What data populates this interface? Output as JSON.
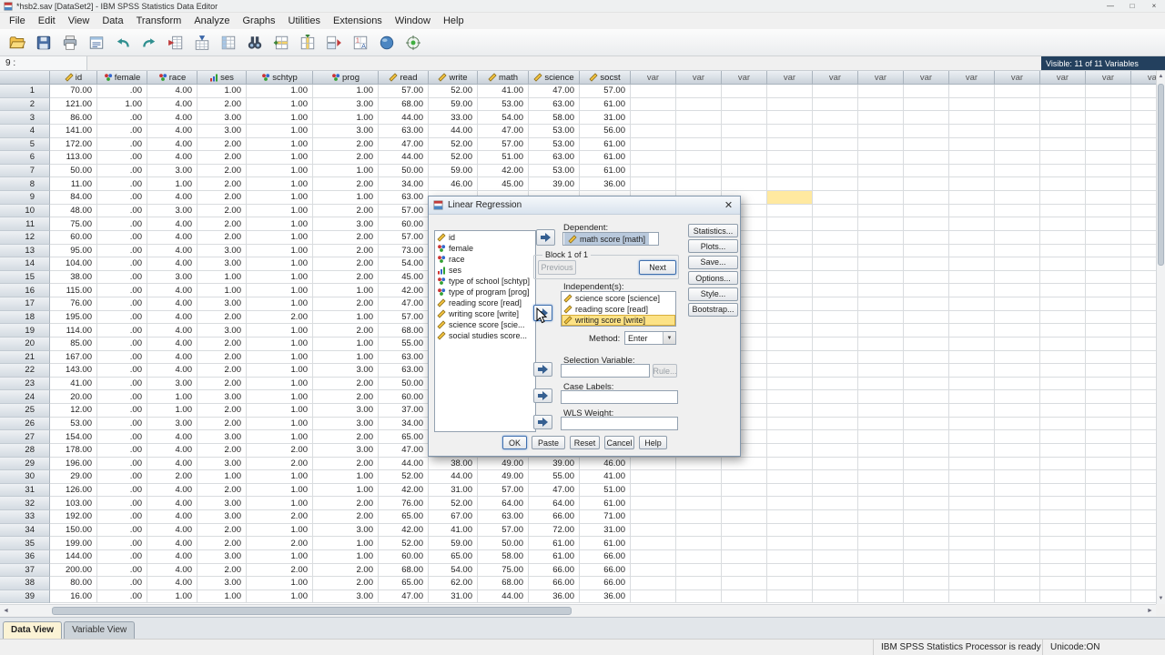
{
  "window": {
    "title": "*hsb2.sav [DataSet2] - IBM SPSS Statistics Data Editor"
  },
  "menu": {
    "items": [
      "File",
      "Edit",
      "View",
      "Data",
      "Transform",
      "Analyze",
      "Graphs",
      "Utilities",
      "Extensions",
      "Window",
      "Help"
    ]
  },
  "toolbar": {
    "icons": [
      "open-data-icon",
      "save-icon",
      "print-icon",
      "recall-dialogs-icon",
      "undo-icon",
      "redo-icon",
      "goto-case-icon",
      "goto-variable-icon",
      "variables-icon",
      "find-icon",
      "insert-cases-icon",
      "insert-variable-icon",
      "split-file-icon",
      "value-labels-icon",
      "use-variable-sets-icon",
      "show-all-variables-icon"
    ]
  },
  "cellref": {
    "value": "9 :"
  },
  "header_info": {
    "visible": "Visible: 11 of 11 Variables"
  },
  "grid": {
    "var_label": "var",
    "columns": [
      {
        "label": "id",
        "measure": "scale"
      },
      {
        "label": "female",
        "measure": "nominal"
      },
      {
        "label": "race",
        "measure": "nominal"
      },
      {
        "label": "ses",
        "measure": "ordinal"
      },
      {
        "label": "schtyp",
        "measure": "nominal"
      },
      {
        "label": "prog",
        "measure": "nominal"
      },
      {
        "label": "read",
        "measure": "scale"
      },
      {
        "label": "write",
        "measure": "scale"
      },
      {
        "label": "math",
        "measure": "scale"
      },
      {
        "label": "science",
        "measure": "scale"
      },
      {
        "label": "socst",
        "measure": "scale"
      }
    ],
    "active_cell": {
      "row": "9",
      "var_index": 3
    },
    "rows": [
      [
        "1",
        "70.00",
        ".00",
        "4.00",
        "1.00",
        "1.00",
        "1.00",
        "57.00",
        "52.00",
        "41.00",
        "47.00",
        "57.00"
      ],
      [
        "2",
        "121.00",
        "1.00",
        "4.00",
        "2.00",
        "1.00",
        "3.00",
        "68.00",
        "59.00",
        "53.00",
        "63.00",
        "61.00"
      ],
      [
        "3",
        "86.00",
        ".00",
        "4.00",
        "3.00",
        "1.00",
        "1.00",
        "44.00",
        "33.00",
        "54.00",
        "58.00",
        "31.00"
      ],
      [
        "4",
        "141.00",
        ".00",
        "4.00",
        "3.00",
        "1.00",
        "3.00",
        "63.00",
        "44.00",
        "47.00",
        "53.00",
        "56.00"
      ],
      [
        "5",
        "172.00",
        ".00",
        "4.00",
        "2.00",
        "1.00",
        "2.00",
        "47.00",
        "52.00",
        "57.00",
        "53.00",
        "61.00"
      ],
      [
        "6",
        "113.00",
        ".00",
        "4.00",
        "2.00",
        "1.00",
        "2.00",
        "44.00",
        "52.00",
        "51.00",
        "63.00",
        "61.00"
      ],
      [
        "7",
        "50.00",
        ".00",
        "3.00",
        "2.00",
        "1.00",
        "1.00",
        "50.00",
        "59.00",
        "42.00",
        "53.00",
        "61.00"
      ],
      [
        "8",
        "11.00",
        ".00",
        "1.00",
        "2.00",
        "1.00",
        "2.00",
        "34.00",
        "46.00",
        "45.00",
        "39.00",
        "36.00"
      ],
      [
        "9",
        "84.00",
        ".00",
        "4.00",
        "2.00",
        "1.00",
        "1.00",
        "63.00",
        "",
        "",
        "",
        ""
      ],
      [
        "10",
        "48.00",
        ".00",
        "3.00",
        "2.00",
        "1.00",
        "2.00",
        "57.00",
        "",
        "",
        "",
        ""
      ],
      [
        "11",
        "75.00",
        ".00",
        "4.00",
        "2.00",
        "1.00",
        "3.00",
        "60.00",
        "",
        "",
        "",
        ""
      ],
      [
        "12",
        "60.00",
        ".00",
        "4.00",
        "2.00",
        "1.00",
        "2.00",
        "57.00",
        "",
        "",
        "",
        ""
      ],
      [
        "13",
        "95.00",
        ".00",
        "4.00",
        "3.00",
        "1.00",
        "2.00",
        "73.00",
        "",
        "",
        "",
        ""
      ],
      [
        "14",
        "104.00",
        ".00",
        "4.00",
        "3.00",
        "1.00",
        "2.00",
        "54.00",
        "",
        "",
        "",
        ""
      ],
      [
        "15",
        "38.00",
        ".00",
        "3.00",
        "1.00",
        "1.00",
        "2.00",
        "45.00",
        "",
        "",
        "",
        ""
      ],
      [
        "16",
        "115.00",
        ".00",
        "4.00",
        "1.00",
        "1.00",
        "1.00",
        "42.00",
        "",
        "",
        "",
        ""
      ],
      [
        "17",
        "76.00",
        ".00",
        "4.00",
        "3.00",
        "1.00",
        "2.00",
        "47.00",
        "",
        "",
        "",
        ""
      ],
      [
        "18",
        "195.00",
        ".00",
        "4.00",
        "2.00",
        "2.00",
        "1.00",
        "57.00",
        "",
        "",
        "",
        ""
      ],
      [
        "19",
        "114.00",
        ".00",
        "4.00",
        "3.00",
        "1.00",
        "2.00",
        "68.00",
        "",
        "",
        "",
        ""
      ],
      [
        "20",
        "85.00",
        ".00",
        "4.00",
        "2.00",
        "1.00",
        "1.00",
        "55.00",
        "",
        "",
        "",
        ""
      ],
      [
        "21",
        "167.00",
        ".00",
        "4.00",
        "2.00",
        "1.00",
        "1.00",
        "63.00",
        "",
        "",
        "",
        ""
      ],
      [
        "22",
        "143.00",
        ".00",
        "4.00",
        "2.00",
        "1.00",
        "3.00",
        "63.00",
        "",
        "",
        "",
        ""
      ],
      [
        "23",
        "41.00",
        ".00",
        "3.00",
        "2.00",
        "1.00",
        "2.00",
        "50.00",
        "",
        "",
        "",
        ""
      ],
      [
        "24",
        "20.00",
        ".00",
        "1.00",
        "3.00",
        "1.00",
        "2.00",
        "60.00",
        "",
        "",
        "",
        ""
      ],
      [
        "25",
        "12.00",
        ".00",
        "1.00",
        "2.00",
        "1.00",
        "3.00",
        "37.00",
        "",
        "",
        "",
        ""
      ],
      [
        "26",
        "53.00",
        ".00",
        "3.00",
        "2.00",
        "1.00",
        "3.00",
        "34.00",
        "",
        "",
        "",
        ""
      ],
      [
        "27",
        "154.00",
        ".00",
        "4.00",
        "3.00",
        "1.00",
        "2.00",
        "65.00",
        "",
        "",
        "",
        ""
      ],
      [
        "28",
        "178.00",
        ".00",
        "4.00",
        "2.00",
        "2.00",
        "3.00",
        "47.00",
        "",
        "",
        "",
        ""
      ],
      [
        "29",
        "196.00",
        ".00",
        "4.00",
        "3.00",
        "2.00",
        "2.00",
        "44.00",
        "38.00",
        "49.00",
        "39.00",
        "46.00"
      ],
      [
        "30",
        "29.00",
        ".00",
        "2.00",
        "1.00",
        "1.00",
        "1.00",
        "52.00",
        "44.00",
        "49.00",
        "55.00",
        "41.00"
      ],
      [
        "31",
        "126.00",
        ".00",
        "4.00",
        "2.00",
        "1.00",
        "1.00",
        "42.00",
        "31.00",
        "57.00",
        "47.00",
        "51.00"
      ],
      [
        "32",
        "103.00",
        ".00",
        "4.00",
        "3.00",
        "1.00",
        "2.00",
        "76.00",
        "52.00",
        "64.00",
        "64.00",
        "61.00"
      ],
      [
        "33",
        "192.00",
        ".00",
        "4.00",
        "3.00",
        "2.00",
        "2.00",
        "65.00",
        "67.00",
        "63.00",
        "66.00",
        "71.00"
      ],
      [
        "34",
        "150.00",
        ".00",
        "4.00",
        "2.00",
        "1.00",
        "3.00",
        "42.00",
        "41.00",
        "57.00",
        "72.00",
        "31.00"
      ],
      [
        "35",
        "199.00",
        ".00",
        "4.00",
        "2.00",
        "2.00",
        "1.00",
        "52.00",
        "59.00",
        "50.00",
        "61.00",
        "61.00"
      ],
      [
        "36",
        "144.00",
        ".00",
        "4.00",
        "3.00",
        "1.00",
        "1.00",
        "60.00",
        "65.00",
        "58.00",
        "61.00",
        "66.00"
      ],
      [
        "37",
        "200.00",
        ".00",
        "4.00",
        "2.00",
        "2.00",
        "2.00",
        "68.00",
        "54.00",
        "75.00",
        "66.00",
        "66.00"
      ],
      [
        "38",
        "80.00",
        ".00",
        "4.00",
        "3.00",
        "1.00",
        "2.00",
        "65.00",
        "62.00",
        "68.00",
        "66.00",
        "66.00"
      ],
      [
        "39",
        "16.00",
        ".00",
        "1.00",
        "1.00",
        "1.00",
        "3.00",
        "47.00",
        "31.00",
        "44.00",
        "36.00",
        "36.00"
      ]
    ]
  },
  "dialog": {
    "title": "Linear Regression",
    "variables": [
      {
        "label": "id",
        "measure": "scale"
      },
      {
        "label": "female",
        "measure": "nominal"
      },
      {
        "label": "race",
        "measure": "nominal"
      },
      {
        "label": "ses",
        "measure": "ordinal"
      },
      {
        "label": "type of school [schtyp]",
        "measure": "nominal"
      },
      {
        "label": "type of program [prog]",
        "measure": "nominal"
      },
      {
        "label": "reading score [read]",
        "measure": "scale"
      },
      {
        "label": "writing score [write]",
        "measure": "scale"
      },
      {
        "label": "science score [scie...",
        "measure": "scale"
      },
      {
        "label": "social studies score...",
        "measure": "scale"
      }
    ],
    "dependent": {
      "label": "math score [math]",
      "measure": "scale"
    },
    "independents": [
      {
        "label": "science score [science]",
        "measure": "scale",
        "highlighted": false
      },
      {
        "label": "reading score [read]",
        "measure": "scale",
        "highlighted": false
      },
      {
        "label": "writing score [write]",
        "measure": "scale",
        "highlighted": true
      }
    ],
    "labels": {
      "dependent": "Dependent:",
      "block": "Block 1 of 1",
      "previous": "Previous",
      "next": "Next",
      "independents": "Independent(s):",
      "method": "Method:",
      "method_value": "Enter",
      "selection_variable": "Selection Variable:",
      "rule": "Rule...",
      "case_labels": "Case Labels:",
      "wls_weight": "WLS Weight:"
    },
    "side_buttons": [
      "Statistics...",
      "Plots...",
      "Save...",
      "Options...",
      "Style...",
      "Bootstrap..."
    ],
    "bottom_buttons": [
      "OK",
      "Paste",
      "Reset",
      "Cancel",
      "Help"
    ]
  },
  "tabs": {
    "data_view": "Data View",
    "variable_view": "Variable View"
  },
  "status": {
    "processor": "IBM SPSS Statistics Processor is ready",
    "unicode": "Unicode:ON"
  }
}
